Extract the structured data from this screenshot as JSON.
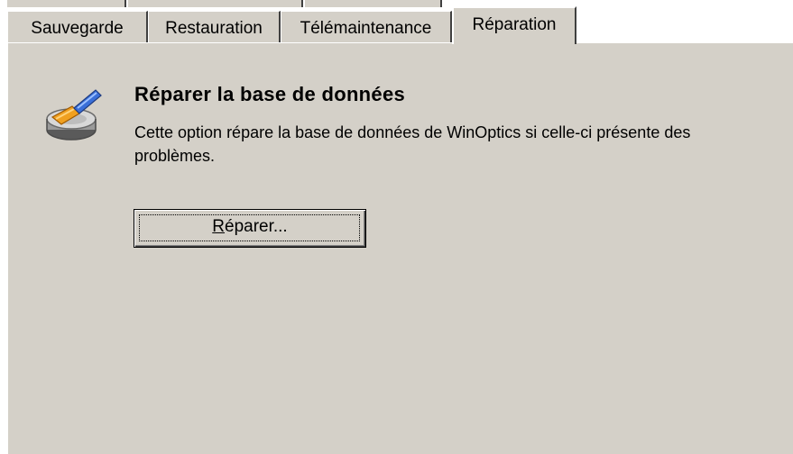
{
  "tabs": [
    {
      "label": "Sauvegarde",
      "active": false
    },
    {
      "label": "Restauration",
      "active": false
    },
    {
      "label": "Télémaintenance",
      "active": false
    },
    {
      "label": "Réparation",
      "active": true
    }
  ],
  "section": {
    "icon": "database-repair-brush-icon",
    "title": "Réparer la base de données",
    "description": "Cette option répare la base de données de WinOptics si celle-ci présente des problèmes."
  },
  "repair_button": {
    "mnemonic": "R",
    "label_rest": "éparer..."
  },
  "colors": {
    "panel_background": "#d4d0c8",
    "highlight": "#ffffff",
    "shadow": "#404040",
    "brush_blue": "#3a6fd8",
    "brush_orange": "#f0a020"
  }
}
